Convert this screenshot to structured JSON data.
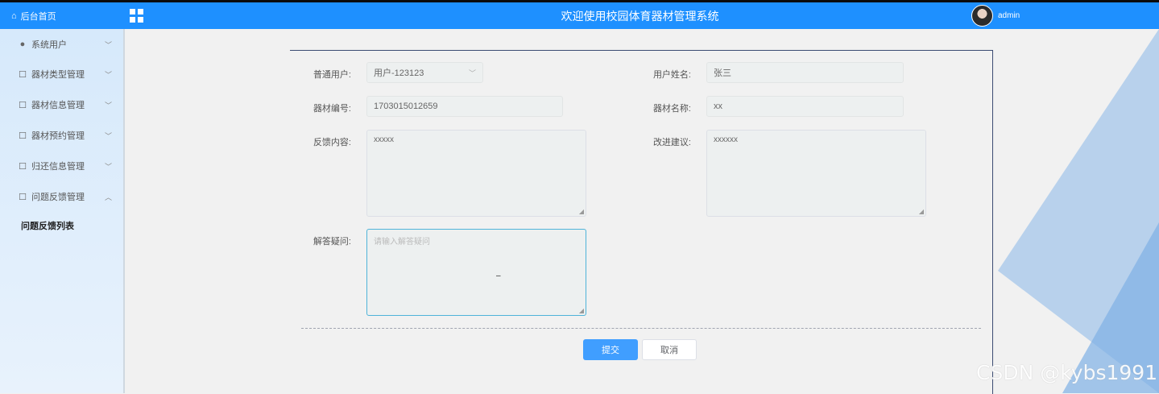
{
  "header": {
    "home_label": "后台首页",
    "system_title": "欢迎使用校园体育器材管理系统",
    "username": "admin",
    "brand_color": "#1e90ff"
  },
  "sidebar": {
    "items": [
      {
        "label": "系统用户",
        "icon": "user-icon"
      },
      {
        "label": "器材类型管理",
        "icon": "box-icon"
      },
      {
        "label": "器材信息管理",
        "icon": "box-icon"
      },
      {
        "label": "器材预约管理",
        "icon": "box-icon"
      },
      {
        "label": "归还信息管理",
        "icon": "box-icon"
      },
      {
        "label": "问题反馈管理",
        "icon": "box-icon"
      }
    ],
    "active_sub": "问题反馈列表"
  },
  "form": {
    "user_label": "普通用户:",
    "user_value": "用户-123123",
    "name_label": "用户姓名:",
    "name_value": "张三",
    "equip_no_label": "器材编号:",
    "equip_no_value": "1703015012659",
    "equip_name_label": "器材名称:",
    "equip_name_value": "xx",
    "feedback_label": "反馈内容:",
    "feedback_value": "xxxxx",
    "suggest_label": "改进建议:",
    "suggest_value": "xxxxxx",
    "answer_label": "解答疑问:",
    "answer_placeholder": "请输入解答疑问"
  },
  "buttons": {
    "submit": "提交",
    "cancel": "取消"
  },
  "watermark": "CSDN @kybs1991"
}
